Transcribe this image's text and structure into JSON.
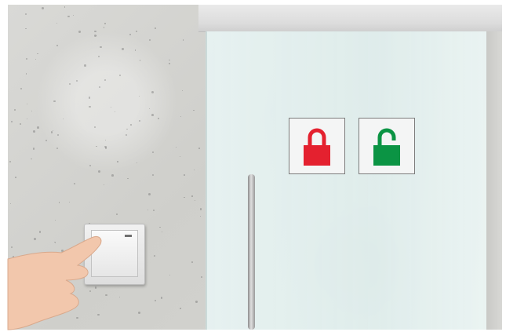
{
  "scene": {
    "description_type": "photo",
    "locked_icon": {
      "icon": "padlock-closed-icon",
      "color": "#e4212f"
    },
    "unlocked_icon": {
      "icon": "padlock-open-icon",
      "color": "#0b9444"
    },
    "colors": {
      "wall": "#d4d4d0",
      "glass": "#e3f0ef",
      "switch": "#eeeeee",
      "skin": "#f2c7ac"
    }
  }
}
